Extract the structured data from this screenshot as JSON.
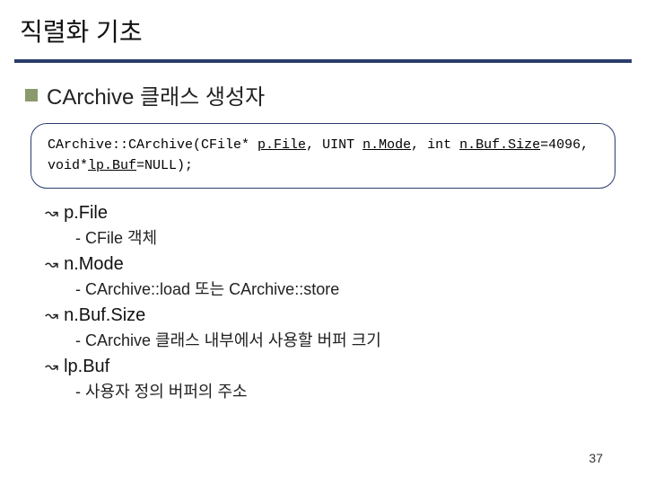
{
  "title": "직렬화 기초",
  "header": {
    "text": "CArchive 클래스 생성자"
  },
  "code": {
    "line1_prefix": "CArchive::CArchive(CFile* ",
    "line1_pfile": "p.File",
    "line1_mid1": ", UINT ",
    "line1_nmode": "n.Mode",
    "line1_mid2": ",   int ",
    "line1_nbufsize": "n.Buf.Size",
    "line1_suffix": "=4096,",
    "line2_prefix": "   void*",
    "line2_lpbuf": "lp.Buf",
    "line2_suffix": "=NULL);"
  },
  "params": [
    {
      "name": "p.File",
      "desc": "- CFile 객체"
    },
    {
      "name": "n.Mode",
      "desc": "- CArchive::load 또는 CArchive::store"
    },
    {
      "name": "n.Buf.Size",
      "desc": "- CArchive 클래스 내부에서 사용할 버퍼 크기"
    },
    {
      "name": "lp.Buf",
      "desc": "- 사용자 정의 버퍼의 주소"
    }
  ],
  "pagenum": "37"
}
